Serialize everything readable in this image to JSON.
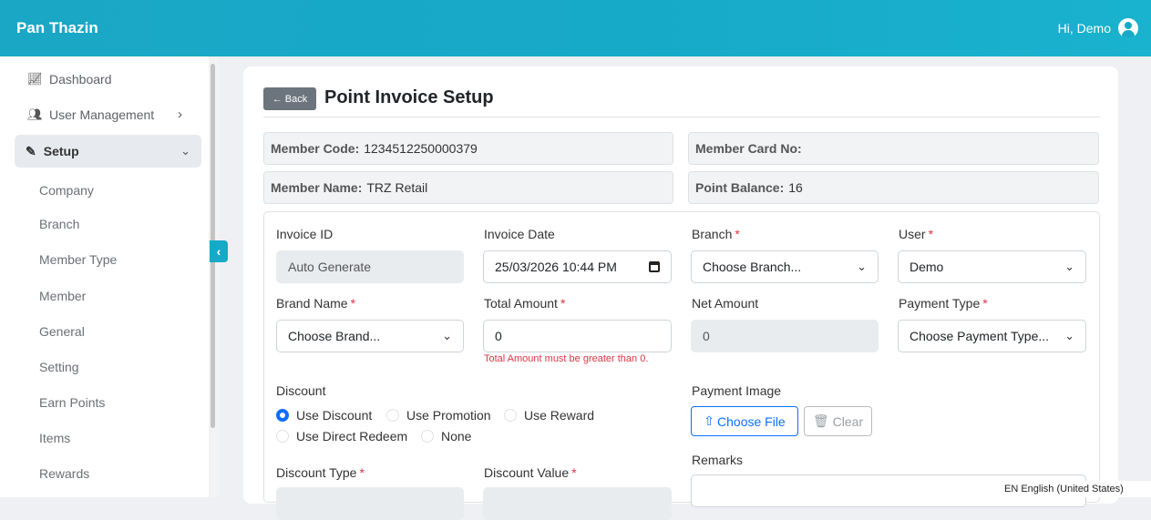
{
  "header": {
    "brand": "Pan Thazin",
    "greeting": "Hi, Demo"
  },
  "sidebar": {
    "items": [
      {
        "label": "Dashboard",
        "icon": "chart-line-icon"
      },
      {
        "label": "User Management",
        "icon": "users-cog-icon"
      },
      {
        "label": "Setup",
        "icon": "edit-icon"
      }
    ],
    "sub_items": [
      "Company",
      "Branch",
      "Member Type",
      "Member",
      "General",
      "Setting",
      "Earn Points",
      "Items",
      "Rewards"
    ]
  },
  "page": {
    "back_label": "← Back",
    "title": "Point Invoice Setup"
  },
  "member": {
    "code_label": "Member Code:",
    "code_value": "1234512250000379",
    "card_label": "Member Card No:",
    "card_value": "",
    "name_label": "Member Name:",
    "name_value": "TRZ Retail",
    "balance_label": "Point Balance:",
    "balance_value": "16"
  },
  "form": {
    "invoice_id": {
      "label": "Invoice ID",
      "value": "Auto Generate"
    },
    "invoice_date": {
      "label": "Invoice Date",
      "value": "25/03/2026 10:44 PM"
    },
    "branch": {
      "label": "Branch",
      "value": "Choose Branch..."
    },
    "user": {
      "label": "User",
      "value": "Demo"
    },
    "brand_name": {
      "label": "Brand Name",
      "value": "Choose Brand..."
    },
    "total_amount": {
      "label": "Total Amount",
      "value": "0",
      "error": "Total Amount must be greater than 0."
    },
    "net_amount": {
      "label": "Net Amount",
      "value": "0"
    },
    "payment_type": {
      "label": "Payment Type",
      "value": "Choose Payment Type..."
    },
    "discount": {
      "label": "Discount",
      "options": [
        "Use Discount",
        "Use Promotion",
        "Use Reward",
        "Use Direct Redeem",
        "None"
      ],
      "selected": "Use Discount"
    },
    "payment_image": {
      "label": "Payment Image",
      "choose_label": "Choose File",
      "clear_label": "Clear"
    },
    "remarks": {
      "label": "Remarks"
    },
    "discount_type": {
      "label": "Discount Type"
    },
    "discount_value": {
      "label": "Discount Value"
    },
    "required_mark": "*"
  },
  "language": "EN English (United States)",
  "colors": {
    "header": "#17a9c8",
    "primary": "#0d6efd",
    "error": "#dc3545",
    "back_button": "#6c757d"
  }
}
